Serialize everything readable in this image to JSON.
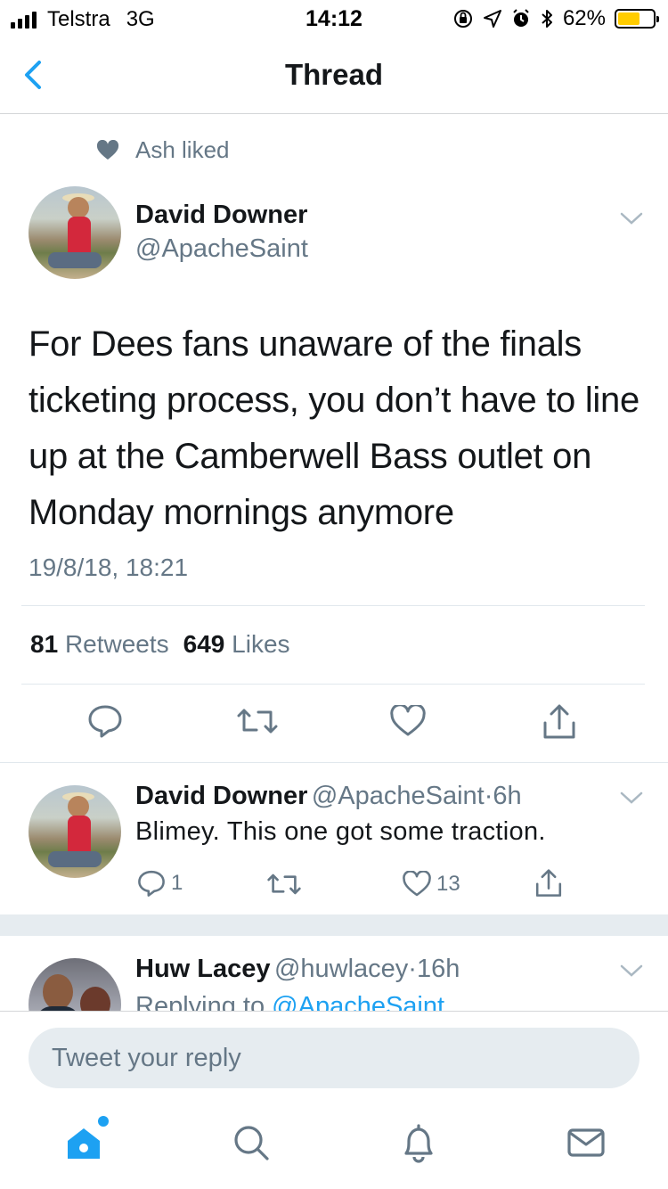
{
  "status_bar": {
    "carrier": "Telstra",
    "network": "3G",
    "time": "14:12",
    "battery_percent": "62%",
    "battery_level": 0.62,
    "icons": [
      "signal-icon",
      "orientation-lock-icon",
      "location-icon",
      "alarm-icon",
      "bluetooth-icon",
      "battery-icon"
    ]
  },
  "nav": {
    "title": "Thread",
    "back_icon": "chevron-left-icon"
  },
  "social_context": {
    "icon": "heart-icon",
    "text": "Ash liked"
  },
  "main_tweet": {
    "name": "David Downer",
    "handle": "@ApacheSaint",
    "text": "For Dees fans unaware of the finals ticketing process, you don’t have to line up at the Camberwell Bass outlet on Monday mornings anymore",
    "timestamp": "19/8/18, 18:21",
    "retweets": "81",
    "retweets_label": "Retweets",
    "likes": "649",
    "likes_label": "Likes",
    "actions": [
      "reply-icon",
      "retweet-icon",
      "like-icon",
      "share-icon"
    ]
  },
  "replies": [
    {
      "name": "David Downer",
      "handle": "@ApacheSaint",
      "time": "6h",
      "separator": "·",
      "text": "Blimey. This one got some traction.",
      "reply_count": "1",
      "retweet_count": "",
      "like_count": "13"
    },
    {
      "name": "Huw Lacey",
      "handle": "@huwlacey",
      "time": "16h",
      "separator": "·",
      "replying_prefix": "Replying to",
      "replying_to": "@ApacheSaint"
    }
  ],
  "composer": {
    "placeholder": "Tweet your reply"
  },
  "tabbar": {
    "items": [
      "home-icon",
      "search-icon",
      "notifications-icon",
      "messages-icon"
    ],
    "active": "home-icon",
    "accent": "#1da1f2"
  },
  "colors": {
    "accent": "#1da1f2",
    "secondary_text": "#657786",
    "primary_text": "#14171a",
    "battery": "#ffcc00"
  }
}
